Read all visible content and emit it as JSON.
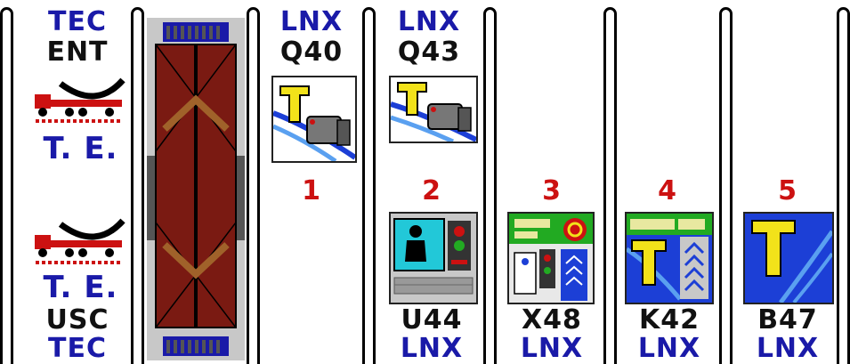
{
  "left_panel": {
    "top_operator": "TEC",
    "top_code": "ENT",
    "top_te": "T. E.",
    "bottom_te": "T. E.",
    "bottom_code": "USC",
    "bottom_operator": "TEC"
  },
  "lanes": [
    {
      "top_operator": "LNX",
      "top_code": "Q40",
      "number": "1",
      "bottom_code": "",
      "bottom_operator": "",
      "icon": "telepass-camera-icon"
    },
    {
      "top_operator": "LNX",
      "top_code": "Q43",
      "number": "2",
      "bottom_code": "U44",
      "bottom_operator": "LNX",
      "icon": "telepass-camera-icon",
      "bottom_icon": "manned-booth-icon"
    },
    {
      "top_operator": "",
      "top_code": "",
      "number": "3",
      "bottom_code": "X48",
      "bottom_operator": "LNX",
      "icon": "fastpay-cash-icon"
    },
    {
      "top_operator": "",
      "top_code": "",
      "number": "4",
      "bottom_code": "K42",
      "bottom_operator": "LNX",
      "icon": "fastpay-telepass-icon"
    },
    {
      "top_operator": "",
      "top_code": "",
      "number": "5",
      "bottom_code": "B47",
      "bottom_operator": "LNX",
      "icon": "telepass-icon"
    }
  ],
  "colors": {
    "operator_blue": "#1a1aa8",
    "lane_red": "#cc1111",
    "truck_red": "#cc1111",
    "brown": "#7a1a12",
    "telepass_yellow": "#f2e21a",
    "telepass_blue": "#1c3fd6"
  }
}
